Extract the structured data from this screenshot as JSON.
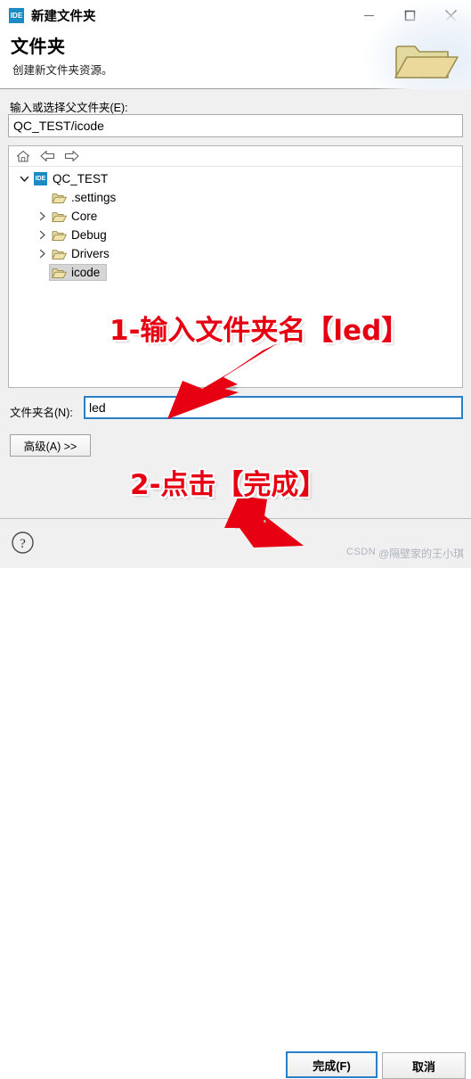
{
  "window": {
    "title": "新建文件夹",
    "app_badge": "IDE",
    "controls": {
      "minimize": "最小化",
      "maximize": "最大化",
      "close": "关闭"
    }
  },
  "header": {
    "title": "文件夹",
    "subtitle": "创建新文件夹资源。",
    "icon": "open-folder-icon"
  },
  "parent_field": {
    "label": "输入或选择父文件夹(E):",
    "value": "QC_TEST/icode"
  },
  "tree_toolbar": {
    "home": "home-icon",
    "back": "back-arrow-icon",
    "forward": "forward-arrow-icon"
  },
  "tree": {
    "items": [
      {
        "label": "QC_TEST",
        "indent": 0,
        "twisty": "expanded",
        "icon": "ide-project-icon",
        "selected": false
      },
      {
        "label": ".settings",
        "indent": 1,
        "twisty": "none",
        "icon": "folder-icon",
        "selected": false
      },
      {
        "label": "Core",
        "indent": 1,
        "twisty": "collapsed",
        "icon": "folder-icon",
        "selected": false
      },
      {
        "label": "Debug",
        "indent": 1,
        "twisty": "collapsed",
        "icon": "folder-icon",
        "selected": false
      },
      {
        "label": "Drivers",
        "indent": 1,
        "twisty": "collapsed",
        "icon": "folder-icon",
        "selected": false
      },
      {
        "label": "icode",
        "indent": 1,
        "twisty": "none",
        "icon": "folder-icon",
        "selected": true
      }
    ]
  },
  "name_field": {
    "label": "文件夹名(N):",
    "value": "led"
  },
  "advanced_button": {
    "label": "高级(A) >>"
  },
  "footer": {
    "help": "help-icon",
    "finish_label": "完成(F)",
    "cancel_label": "取消"
  },
  "annotations": [
    {
      "id": "annot-1",
      "text": "1-输入文件夹名【led】",
      "color": "#e60012"
    },
    {
      "id": "annot-2",
      "text": "2-点击【完成】",
      "color": "#e60012"
    }
  ],
  "watermark": {
    "site": "CSDN",
    "user": "@隔壁家的王小琪"
  }
}
